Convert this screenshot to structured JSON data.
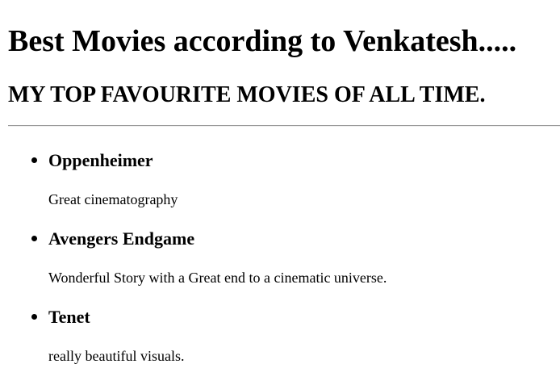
{
  "page": {
    "heading": "Best Movies according to Venkatesh.....",
    "subheading": "MY TOP FAVOURITE MOVIES OF ALL TIME."
  },
  "movies": [
    {
      "title": "Oppenheimer",
      "description": "Great cinematography"
    },
    {
      "title": "Avengers Endgame",
      "description": "Wonderful Story with a Great end to a cinematic universe."
    },
    {
      "title": "Tenet",
      "description": "really beautiful visuals."
    }
  ]
}
